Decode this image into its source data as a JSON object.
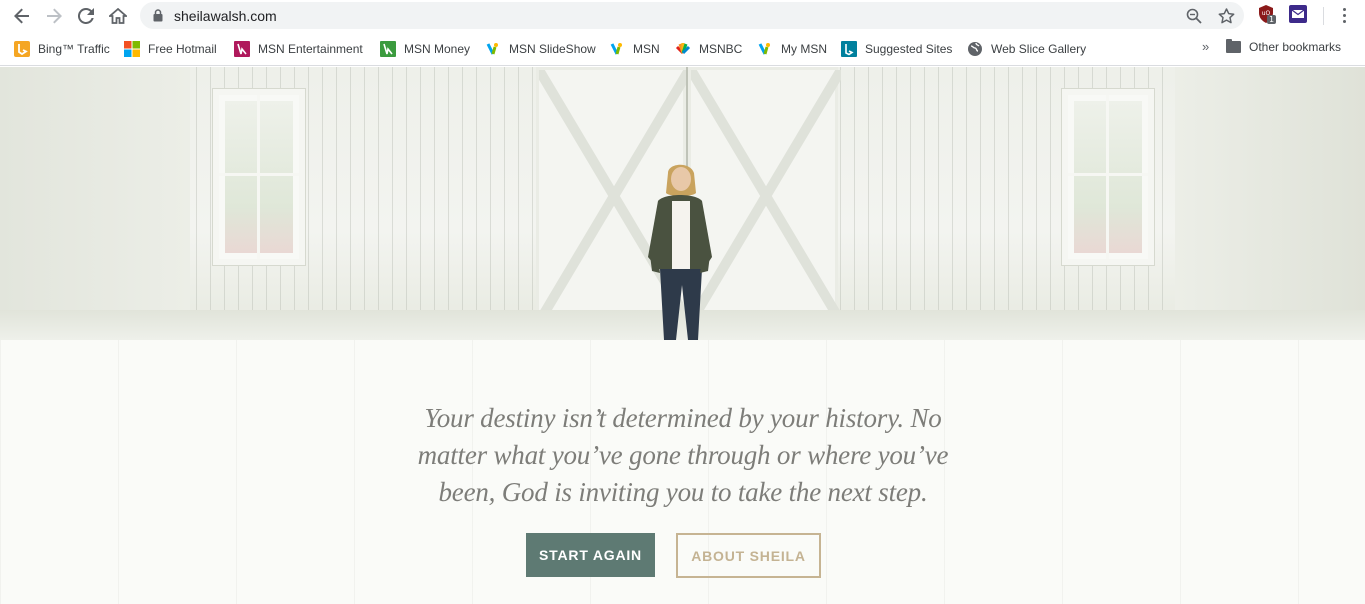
{
  "browser": {
    "url": "sheilawalsh.com",
    "extension_badge": "1",
    "icons": [
      "back-arrow-icon",
      "forward-arrow-icon",
      "reload-icon",
      "home-icon",
      "lock-icon",
      "zoom-icon",
      "star-icon",
      "shield-extension-icon",
      "mail-extension-icon",
      "menu-dots-icon"
    ]
  },
  "bookmarks": {
    "items": [
      {
        "label": "Bing™ Traffic",
        "icon": "bing-icon"
      },
      {
        "label": "Free Hotmail",
        "icon": "windows-icon"
      },
      {
        "label": "MSN Entertainment",
        "icon": "msn-entertainment-icon"
      },
      {
        "label": "MSN Money",
        "icon": "msn-money-icon"
      },
      {
        "label": "MSN SlideShow",
        "icon": "msn-butterfly-icon"
      },
      {
        "label": "MSN",
        "icon": "msn-butterfly-icon"
      },
      {
        "label": "MSNBC",
        "icon": "peacock-icon"
      },
      {
        "label": "My MSN",
        "icon": "msn-butterfly-icon"
      },
      {
        "label": "Suggested Sites",
        "icon": "bing-b-icon"
      },
      {
        "label": "Web Slice Gallery",
        "icon": "globe-icon"
      }
    ],
    "overflow": "»",
    "other_label": "Other bookmarks"
  },
  "hero": {
    "quote": "Your destiny isn’t determined by your history. No matter what you’ve gone through or where you’ve been, God is inviting you to take the next step.",
    "primary_button": "START AGAIN",
    "secondary_button": "ABOUT SHEILA"
  },
  "colors": {
    "primary_button_bg": "#5e7a73",
    "secondary_button_border": "#c6b493",
    "quote_text": "#7d7d79"
  }
}
